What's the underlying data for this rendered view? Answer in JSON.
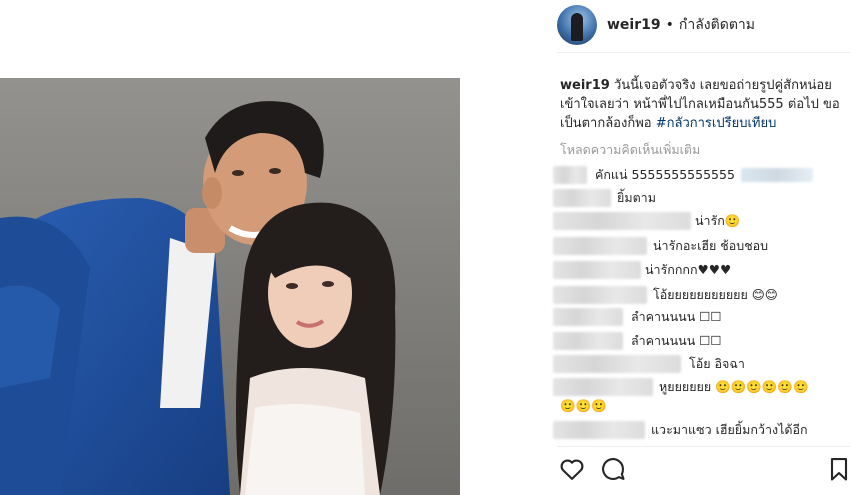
{
  "post": {
    "header": {
      "username": "weir19",
      "separator": "•",
      "follow_status": "กำลังติดตาม"
    },
    "caption": {
      "username": "weir19",
      "text": "วันนี้เจอตัวจริง เลยขอถ่ายรูปคู่สักหน่อย เข้าใจเลยว่า หน้าพี่ไปไกลเหมือนกัน555 ต่อไป ขอเป็นตากล้องก็พอ",
      "hashtag": "#กลัวการเปรียบเทียบ"
    },
    "load_more_label": "โหลดความคิดเห็นเพิ่มเติม",
    "comments": [
      {
        "text": "คักแน่ 5555555555555"
      },
      {
        "text": "ยิ้มตาม"
      },
      {
        "text": "น่ารัก🙂"
      },
      {
        "text": "น่ารักอะเฮีย ช้อบชอบ"
      },
      {
        "text": "น่ารักกกก♥♥♥"
      },
      {
        "text": "โอ้ยยยยยยยยยยย 😊😊"
      },
      {
        "text": "ลำคานนนน ☐☐"
      },
      {
        "text": "ลำคานนนน ☐☐"
      },
      {
        "text": "โอ้ย อิจฉา"
      },
      {
        "text": "หูยยยยยย 🙂🙂🙂🙂🙂🙂"
      },
      {
        "text": "🙂🙂🙂"
      },
      {
        "text": "แวะมาแซว เฮียยิ้มกว้างได้อีก"
      }
    ],
    "actions": {
      "like_icon": "heart-outline-icon",
      "comment_icon": "speech-bubble-icon",
      "save_icon": "bookmark-outline-icon"
    },
    "colors": {
      "hashtag": "#003569",
      "muted": "#999999",
      "text": "#262626",
      "suit": "#1f4f9a"
    }
  }
}
